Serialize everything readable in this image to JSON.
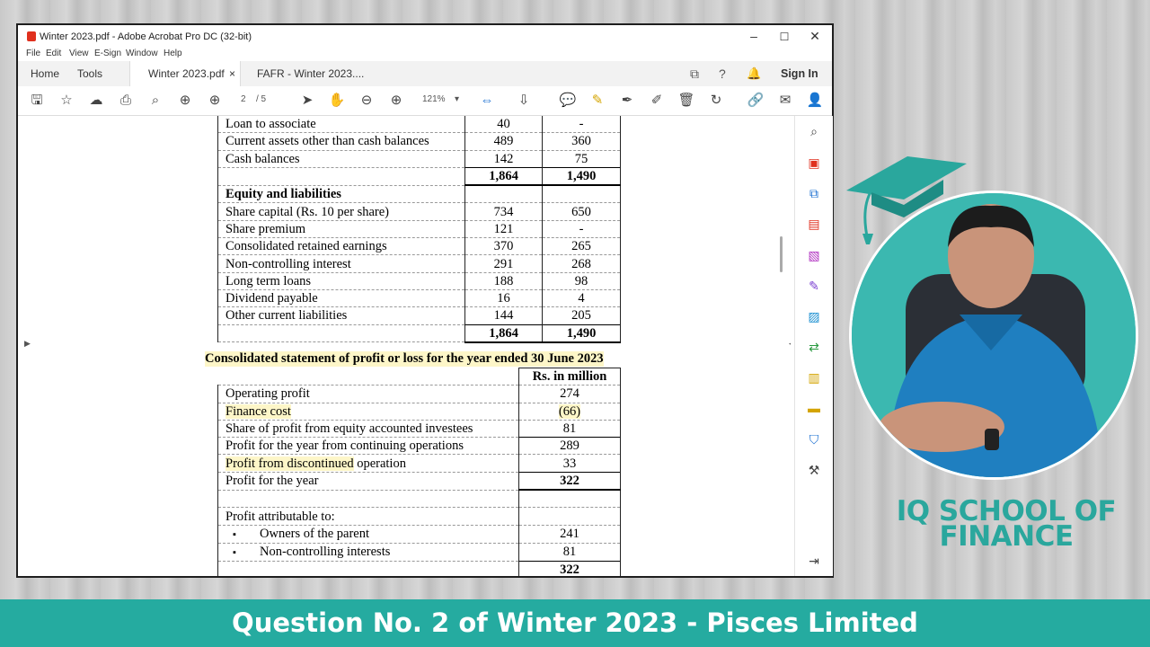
{
  "window": {
    "title": "Winter 2023.pdf - Adobe Acrobat Pro DC (32-bit)",
    "controls": [
      "–",
      "☐",
      "✕"
    ]
  },
  "menu": [
    "File",
    "Edit",
    "View",
    "E-Sign",
    "Window",
    "Help"
  ],
  "tabs": {
    "home": "Home",
    "tools": "Tools",
    "active_doc": "Winter 2023.pdf",
    "close": "×",
    "other_doc": "FAFR - Winter 2023....",
    "sign_in": "Sign In"
  },
  "toolbar": {
    "page_current": "2",
    "page_total": "/ 5",
    "zoom": "121%"
  },
  "balance_sheet": {
    "rows": [
      {
        "label": "Loan to associate",
        "a": "40",
        "b": "-"
      },
      {
        "label": "Current assets other than cash balances",
        "a": "489",
        "b": "360"
      },
      {
        "label": "Cash balances",
        "a": "142",
        "b": "75"
      }
    ],
    "total1": {
      "a": "1,864",
      "b": "1,490"
    },
    "equity_heading": "Equity and liabilities",
    "equity_rows": [
      {
        "label": "Share capital (Rs. 10 per share)",
        "a": "734",
        "b": "650"
      },
      {
        "label": "Share premium",
        "a": "121",
        "b": "-"
      },
      {
        "label": "Consolidated retained earnings",
        "a": "370",
        "b": "265"
      },
      {
        "label": "Non-controlling interest",
        "a": "291",
        "b": "268"
      },
      {
        "label": "Long term loans",
        "a": "188",
        "b": "98"
      },
      {
        "label": "Dividend payable",
        "a": "16",
        "b": "4"
      },
      {
        "label": "Other current liabilities",
        "a": "144",
        "b": "205"
      }
    ],
    "total2": {
      "a": "1,864",
      "b": "1,490"
    }
  },
  "profit_loss": {
    "title": "Consolidated statement of profit or loss for the year ended 30 June 2023",
    "unit_header": "Rs. in million",
    "rows": [
      {
        "label": "Operating profit",
        "value": "274"
      },
      {
        "label": "Finance cost",
        "value": "(66)"
      },
      {
        "label": "Share of profit from equity accounted investees",
        "value": "81"
      },
      {
        "label": "Profit for the year from continuing operations",
        "value": "289"
      },
      {
        "label_hl": "Profit from discontinued",
        "label_rest": " operation",
        "value": "33"
      },
      {
        "label": "Profit for the year",
        "value": "322"
      }
    ],
    "attributable_heading": "Profit attributable to:",
    "bullet": "▪",
    "attributable": [
      {
        "label": "Owners of the parent",
        "value": "241"
      },
      {
        "label": "Non-controlling interests",
        "value": "81"
      }
    ],
    "attributable_total": "322"
  },
  "branding": {
    "school_line1": "IQ SCHOOL OF",
    "school_line2": "FINANCE"
  },
  "banner": "Question No. 2 of Winter 2023 - Pisces Limited"
}
